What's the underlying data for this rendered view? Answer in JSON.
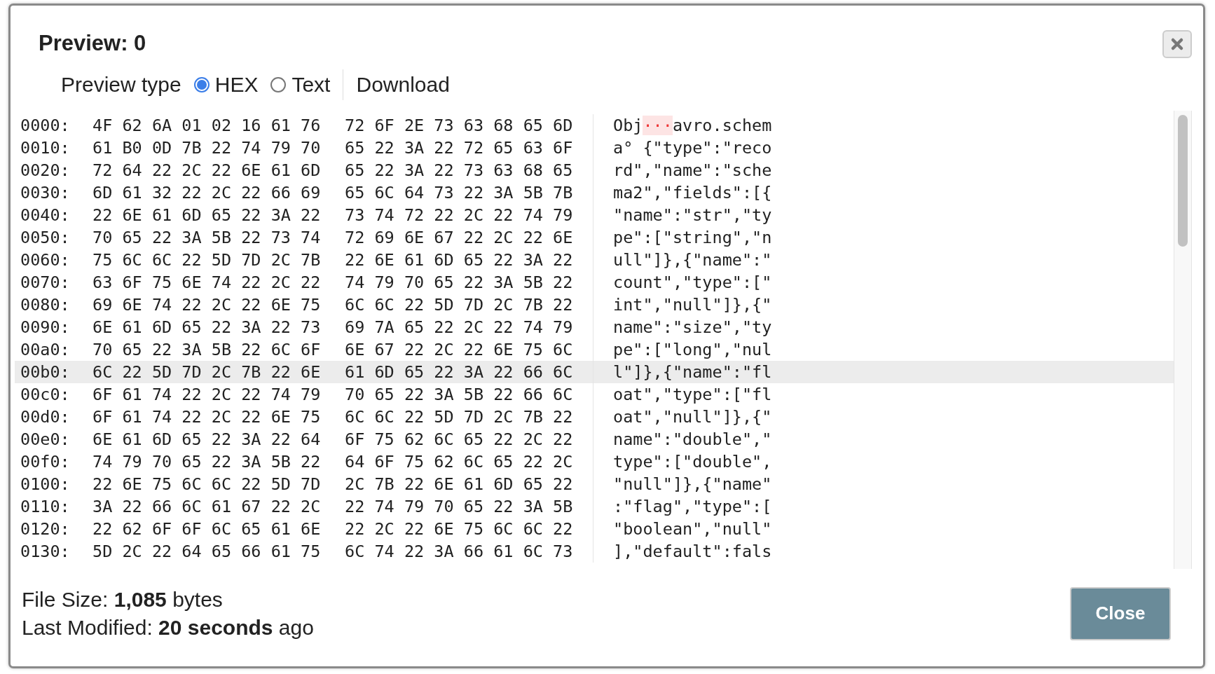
{
  "dialog": {
    "title": "Preview: 0"
  },
  "preview_type": {
    "label": "Preview type",
    "options": [
      {
        "label": "HEX",
        "selected": true
      },
      {
        "label": "Text",
        "selected": false
      }
    ],
    "download": "Download"
  },
  "hex_view": {
    "rows": [
      {
        "offset": "0000:",
        "hex_1": "4F 62 6A 01 02 16 61 76",
        "hex_2": "72 6F 2E 73 63 68 65 6D",
        "text": [
          {
            "kind": "plain",
            "text": "Obj"
          },
          {
            "kind": "control",
            "text": "···"
          },
          {
            "kind": "plain",
            "text": "avro.schem"
          }
        ],
        "selected": false
      },
      {
        "offset": "0010:",
        "hex_1": "61 B0 0D 7B 22 74 79 70",
        "hex_2": "65 22 3A 22 72 65 63 6F",
        "text": [
          {
            "kind": "plain",
            "text": "a° {\"type\":\"reco"
          }
        ],
        "selected": false
      },
      {
        "offset": "0020:",
        "hex_1": "72 64 22 2C 22 6E 61 6D",
        "hex_2": "65 22 3A 22 73 63 68 65",
        "text": [
          {
            "kind": "plain",
            "text": "rd\",\"name\":\"sche"
          }
        ],
        "selected": false
      },
      {
        "offset": "0030:",
        "hex_1": "6D 61 32 22 2C 22 66 69",
        "hex_2": "65 6C 64 73 22 3A 5B 7B",
        "text": [
          {
            "kind": "plain",
            "text": "ma2\",\"fields\":[{"
          }
        ],
        "selected": false
      },
      {
        "offset": "0040:",
        "hex_1": "22 6E 61 6D 65 22 3A 22",
        "hex_2": "73 74 72 22 2C 22 74 79",
        "text": [
          {
            "kind": "plain",
            "text": "\"name\":\"str\",\"ty"
          }
        ],
        "selected": false
      },
      {
        "offset": "0050:",
        "hex_1": "70 65 22 3A 5B 22 73 74",
        "hex_2": "72 69 6E 67 22 2C 22 6E",
        "text": [
          {
            "kind": "plain",
            "text": "pe\":[\"string\",\"n"
          }
        ],
        "selected": false
      },
      {
        "offset": "0060:",
        "hex_1": "75 6C 6C 22 5D 7D 2C 7B",
        "hex_2": "22 6E 61 6D 65 22 3A 22",
        "text": [
          {
            "kind": "plain",
            "text": "ull\"]},{\"name\":\""
          }
        ],
        "selected": false
      },
      {
        "offset": "0070:",
        "hex_1": "63 6F 75 6E 74 22 2C 22",
        "hex_2": "74 79 70 65 22 3A 5B 22",
        "text": [
          {
            "kind": "plain",
            "text": "count\",\"type\":[\""
          }
        ],
        "selected": false
      },
      {
        "offset": "0080:",
        "hex_1": "69 6E 74 22 2C 22 6E 75",
        "hex_2": "6C 6C 22 5D 7D 2C 7B 22",
        "text": [
          {
            "kind": "plain",
            "text": "int\",\"null\"]},{\""
          }
        ],
        "selected": false
      },
      {
        "offset": "0090:",
        "hex_1": "6E 61 6D 65 22 3A 22 73",
        "hex_2": "69 7A 65 22 2C 22 74 79",
        "text": [
          {
            "kind": "plain",
            "text": "name\":\"size\",\"ty"
          }
        ],
        "selected": false
      },
      {
        "offset": "00a0:",
        "hex_1": "70 65 22 3A 5B 22 6C 6F",
        "hex_2": "6E 67 22 2C 22 6E 75 6C",
        "text": [
          {
            "kind": "plain",
            "text": "pe\":[\"long\",\"nul"
          }
        ],
        "selected": false
      },
      {
        "offset": "00b0:",
        "hex_1": "6C 22 5D 7D 2C 7B 22 6E",
        "hex_2": "61 6D 65 22 3A 22 66 6C",
        "text": [
          {
            "kind": "plain",
            "text": "l\"]},{\"name\":\"fl"
          }
        ],
        "selected": true
      },
      {
        "offset": "00c0:",
        "hex_1": "6F 61 74 22 2C 22 74 79",
        "hex_2": "70 65 22 3A 5B 22 66 6C",
        "text": [
          {
            "kind": "plain",
            "text": "oat\",\"type\":[\"fl"
          }
        ],
        "selected": false
      },
      {
        "offset": "00d0:",
        "hex_1": "6F 61 74 22 2C 22 6E 75",
        "hex_2": "6C 6C 22 5D 7D 2C 7B 22",
        "text": [
          {
            "kind": "plain",
            "text": "oat\",\"null\"]},{\""
          }
        ],
        "selected": false
      },
      {
        "offset": "00e0:",
        "hex_1": "6E 61 6D 65 22 3A 22 64",
        "hex_2": "6F 75 62 6C 65 22 2C 22",
        "text": [
          {
            "kind": "plain",
            "text": "name\":\"double\",\""
          }
        ],
        "selected": false
      },
      {
        "offset": "00f0:",
        "hex_1": "74 79 70 65 22 3A 5B 22",
        "hex_2": "64 6F 75 62 6C 65 22 2C",
        "text": [
          {
            "kind": "plain",
            "text": "type\":[\"double\","
          }
        ],
        "selected": false
      },
      {
        "offset": "0100:",
        "hex_1": "22 6E 75 6C 6C 22 5D 7D",
        "hex_2": "2C 7B 22 6E 61 6D 65 22",
        "text": [
          {
            "kind": "plain",
            "text": "\"null\"]},{\"name\""
          }
        ],
        "selected": false
      },
      {
        "offset": "0110:",
        "hex_1": "3A 22 66 6C 61 67 22 2C",
        "hex_2": "22 74 79 70 65 22 3A 5B",
        "text": [
          {
            "kind": "plain",
            "text": ":\"flag\",\"type\":["
          }
        ],
        "selected": false
      },
      {
        "offset": "0120:",
        "hex_1": "22 62 6F 6F 6C 65 61 6E",
        "hex_2": "22 2C 22 6E 75 6C 6C 22",
        "text": [
          {
            "kind": "plain",
            "text": "\"boolean\",\"null\""
          }
        ],
        "selected": false
      },
      {
        "offset": "0130:",
        "hex_1": "5D 2C 22 64 65 66 61 75",
        "hex_2": "6C 74 22 3A 66 61 6C 73",
        "text": [
          {
            "kind": "plain",
            "text": "],\"default\":fals"
          }
        ],
        "selected": false
      }
    ]
  },
  "footer": {
    "file_size": "File Size: **1,085** bytes",
    "last_modified": "Last Modified: **20 seconds** ago",
    "close": "Close"
  }
}
